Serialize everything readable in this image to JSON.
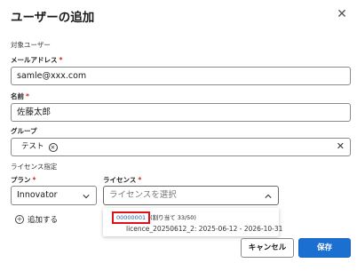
{
  "dialog": {
    "title": "ユーザーの追加"
  },
  "target_users": {
    "section_label": "対象ユーザー",
    "email": {
      "label": "メールアドレス",
      "required": "*",
      "value": "samle@xxx.com"
    },
    "name": {
      "label": "名前",
      "required": "*",
      "value": "佐藤太郎"
    },
    "group": {
      "label": "グループ",
      "chips": [
        {
          "label": "テスト"
        }
      ]
    }
  },
  "license_spec": {
    "section_label": "ライセンス指定",
    "plan": {
      "label": "プラン",
      "required": "*",
      "value": "Innovator"
    },
    "license": {
      "label": "ライセンス",
      "required": "*",
      "placeholder": "ライセンスを選択"
    },
    "add_label": "追加する",
    "dropdown": {
      "id": "00000001",
      "assign_text": "(割り当て 33/50)",
      "option": "licence_20250612_2: 2025-06-12 - 2026-10-31"
    }
  },
  "footer": {
    "cancel_label": "キャンセル",
    "save_label": "保存"
  },
  "colors": {
    "primary": "#1a6fd1",
    "required": "#d0271d",
    "highlight_border": "#e0101a"
  },
  "icons": {
    "close": "close-icon",
    "chip_remove": "circle-x-icon",
    "clear": "close-icon",
    "plan_chevron": "chevron-down-icon",
    "license_chevron": "chevron-up-icon",
    "add": "plus-circle-icon"
  }
}
